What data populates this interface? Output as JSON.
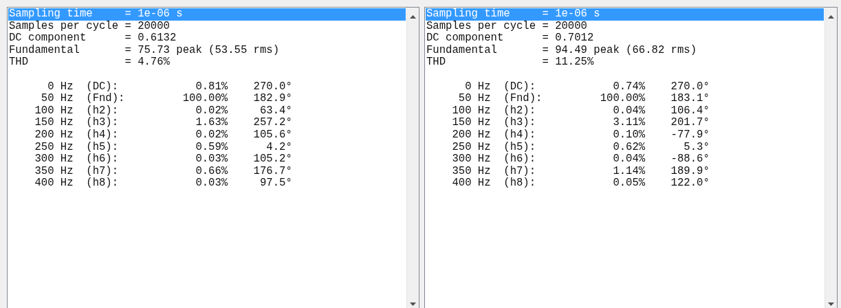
{
  "panels": [
    {
      "summary": [
        {
          "text": "Sampling time     = 1e-06 s",
          "selected": true
        },
        {
          "text": "Samples per cycle = 20000",
          "selected": false
        },
        {
          "text": "DC component      = 0.6132",
          "selected": false
        },
        {
          "text": "Fundamental       = 75.73 peak (53.55 rms)",
          "selected": false
        },
        {
          "text": "THD               = 4.76%",
          "selected": false
        }
      ],
      "harmonics": [
        {
          "text": "      0 Hz  (DC):            0.81%    270.0°",
          "selected": false
        },
        {
          "text": "     50 Hz  (Fnd):         100.00%    182.9°",
          "selected": false
        },
        {
          "text": "    100 Hz  (h2):            0.02%     63.4°",
          "selected": false
        },
        {
          "text": "    150 Hz  (h3):            1.63%    257.2°",
          "selected": false
        },
        {
          "text": "    200 Hz  (h4):            0.02%    105.6°",
          "selected": false
        },
        {
          "text": "    250 Hz  (h5):            0.59%      4.2°",
          "selected": false
        },
        {
          "text": "    300 Hz  (h6):            0.03%    105.2°",
          "selected": false
        },
        {
          "text": "    350 Hz  (h7):            0.66%    176.7°",
          "selected": false
        },
        {
          "text": "    400 Hz  (h8):            0.03%     97.5°",
          "selected": false
        }
      ]
    },
    {
      "summary": [
        {
          "text": "Sampling time     = 1e-06 s",
          "selected": true
        },
        {
          "text": "Samples per cycle = 20000",
          "selected": false
        },
        {
          "text": "DC component      = 0.7012",
          "selected": false
        },
        {
          "text": "Fundamental       = 94.49 peak (66.82 rms)",
          "selected": false
        },
        {
          "text": "THD               = 11.25%",
          "selected": false
        }
      ],
      "harmonics": [
        {
          "text": "      0 Hz  (DC):            0.74%    270.0°",
          "selected": false
        },
        {
          "text": "     50 Hz  (Fnd):         100.00%    183.1°",
          "selected": false
        },
        {
          "text": "    100 Hz  (h2):            0.04%    106.4°",
          "selected": false
        },
        {
          "text": "    150 Hz  (h3):            3.11%    201.7°",
          "selected": false
        },
        {
          "text": "    200 Hz  (h4):            0.10%    -77.9°",
          "selected": false
        },
        {
          "text": "    250 Hz  (h5):            0.62%      5.3°",
          "selected": false
        },
        {
          "text": "    300 Hz  (h6):            0.04%    -88.6°",
          "selected": false
        },
        {
          "text": "    350 Hz  (h7):            1.14%    189.9°",
          "selected": false
        },
        {
          "text": "    400 Hz  (h8):            0.05%    122.0°",
          "selected": false
        }
      ]
    }
  ]
}
